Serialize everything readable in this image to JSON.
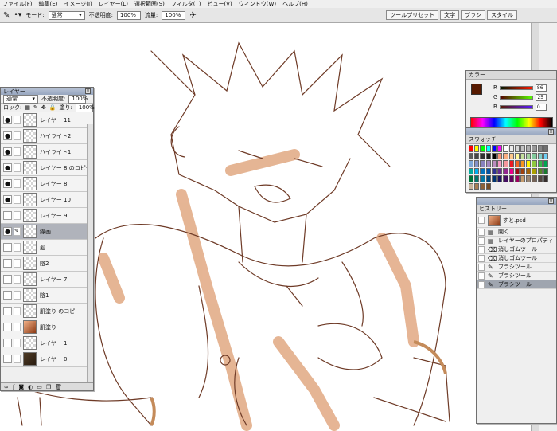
{
  "menu": [
    "ファイル(F)",
    "編集(E)",
    "イメージ(I)",
    "レイヤー(L)",
    "選択範囲(S)",
    "フィルタ(T)",
    "ビュー(V)",
    "ウィンドウ(W)",
    "ヘルプ(H)"
  ],
  "options": {
    "mode_label": "モード:",
    "mode_value": "通常",
    "opacity_label": "不透明度:",
    "opacity_value": "100%",
    "flow_label": "流量:",
    "flow_value": "100%"
  },
  "top_tabs": [
    "ツールプリセット",
    "文字",
    "ブラシ",
    "スタイル"
  ],
  "layers": {
    "title": "レイヤー",
    "blend_mode": "通常",
    "opacity_label": "不透明度:",
    "opacity_value": "100%",
    "lock_label": "ロック:",
    "fill_label": "塗り:",
    "fill_value": "100%",
    "items": [
      {
        "name": "レイヤー 11",
        "visible": true,
        "locked": false,
        "thumb": "checker"
      },
      {
        "name": "ハイライト2",
        "visible": true,
        "locked": false,
        "thumb": "checker"
      },
      {
        "name": "ハイライト1",
        "visible": true,
        "locked": true,
        "thumb": "checker"
      },
      {
        "name": "レイヤー 8 のコピー",
        "visible": true,
        "locked": false,
        "thumb": "checker"
      },
      {
        "name": "レイヤー 8",
        "visible": true,
        "locked": false,
        "thumb": "checker"
      },
      {
        "name": "レイヤー 10",
        "visible": true,
        "locked": false,
        "thumb": "checker"
      },
      {
        "name": "レイヤー 9",
        "visible": false,
        "locked": false,
        "thumb": "checker"
      },
      {
        "name": "線画",
        "visible": true,
        "locked": false,
        "thumb": "checker",
        "active": true
      },
      {
        "name": "髪",
        "visible": false,
        "locked": false,
        "thumb": "checker"
      },
      {
        "name": "陰2",
        "visible": false,
        "locked": false,
        "thumb": "checker"
      },
      {
        "name": "レイヤー 7",
        "visible": false,
        "locked": false,
        "thumb": "checker"
      },
      {
        "name": "陰1",
        "visible": false,
        "locked": false,
        "thumb": "checker"
      },
      {
        "name": "肌塗り のコピー",
        "visible": false,
        "locked": true,
        "thumb": "checker"
      },
      {
        "name": "肌塗り",
        "visible": false,
        "locked": true,
        "thumb": "art"
      },
      {
        "name": "レイヤー 1",
        "visible": false,
        "locked": false,
        "thumb": "checker"
      },
      {
        "name": "レイヤー 0",
        "visible": false,
        "locked": false,
        "thumb": "dark"
      }
    ]
  },
  "color": {
    "title": "カラー",
    "r_label": "R",
    "r_value": "86",
    "g_label": "G",
    "g_value": "25",
    "b_label": "B",
    "b_value": "0",
    "foreground": "#561900"
  },
  "swatches": {
    "title": "スウォッチ",
    "colors": [
      "#ff0000",
      "#ffff00",
      "#00ff00",
      "#00ffff",
      "#0000ff",
      "#ff00ff",
      "#ffffff",
      "#ebebeb",
      "#d6d6d6",
      "#c2c2c2",
      "#adadad",
      "#999999",
      "#858585",
      "#707070",
      "#5c5c5c",
      "#474747",
      "#333333",
      "#1f1f1f",
      "#000000",
      "#f7977a",
      "#f9ad81",
      "#fdc68a",
      "#fff79a",
      "#c4df9b",
      "#a2d39c",
      "#82ca9d",
      "#7bcdc8",
      "#6ecff6",
      "#7ea7d8",
      "#8493ca",
      "#8882be",
      "#a187be",
      "#bc8dbf",
      "#f49ac2",
      "#f6989d",
      "#ed1c24",
      "#f26522",
      "#f7941d",
      "#fff200",
      "#8dc73f",
      "#39b54a",
      "#00a651",
      "#00a99d",
      "#00aeef",
      "#0072bc",
      "#0054a6",
      "#2e3192",
      "#662d91",
      "#92278f",
      "#ec008c",
      "#9e0b0f",
      "#a0410d",
      "#a3620a",
      "#aba000",
      "#598527",
      "#1a7b30",
      "#007236",
      "#00746b",
      "#0076a3",
      "#004a80",
      "#003471",
      "#1b1464",
      "#440e62",
      "#630460",
      "#9e005d",
      "#c69c6d",
      "#998675",
      "#736357",
      "#534741",
      "#362f2d",
      "#c7b299",
      "#a67c52",
      "#8c6239",
      "#754c24"
    ]
  },
  "history": {
    "title": "ヒストリー",
    "snapshot": "すと.psd",
    "items": [
      {
        "label": "開く",
        "icon": "document-icon"
      },
      {
        "label": "レイヤーのプロパティ",
        "icon": "document-icon"
      },
      {
        "label": "消しゴムツール",
        "icon": "eraser-icon"
      },
      {
        "label": "消しゴムツール",
        "icon": "eraser-icon"
      },
      {
        "label": "ブラシツール",
        "icon": "brush-icon"
      },
      {
        "label": "ブラシツール",
        "icon": "brush-icon"
      },
      {
        "label": "ブラシツール",
        "icon": "brush-icon",
        "active": true
      }
    ]
  }
}
